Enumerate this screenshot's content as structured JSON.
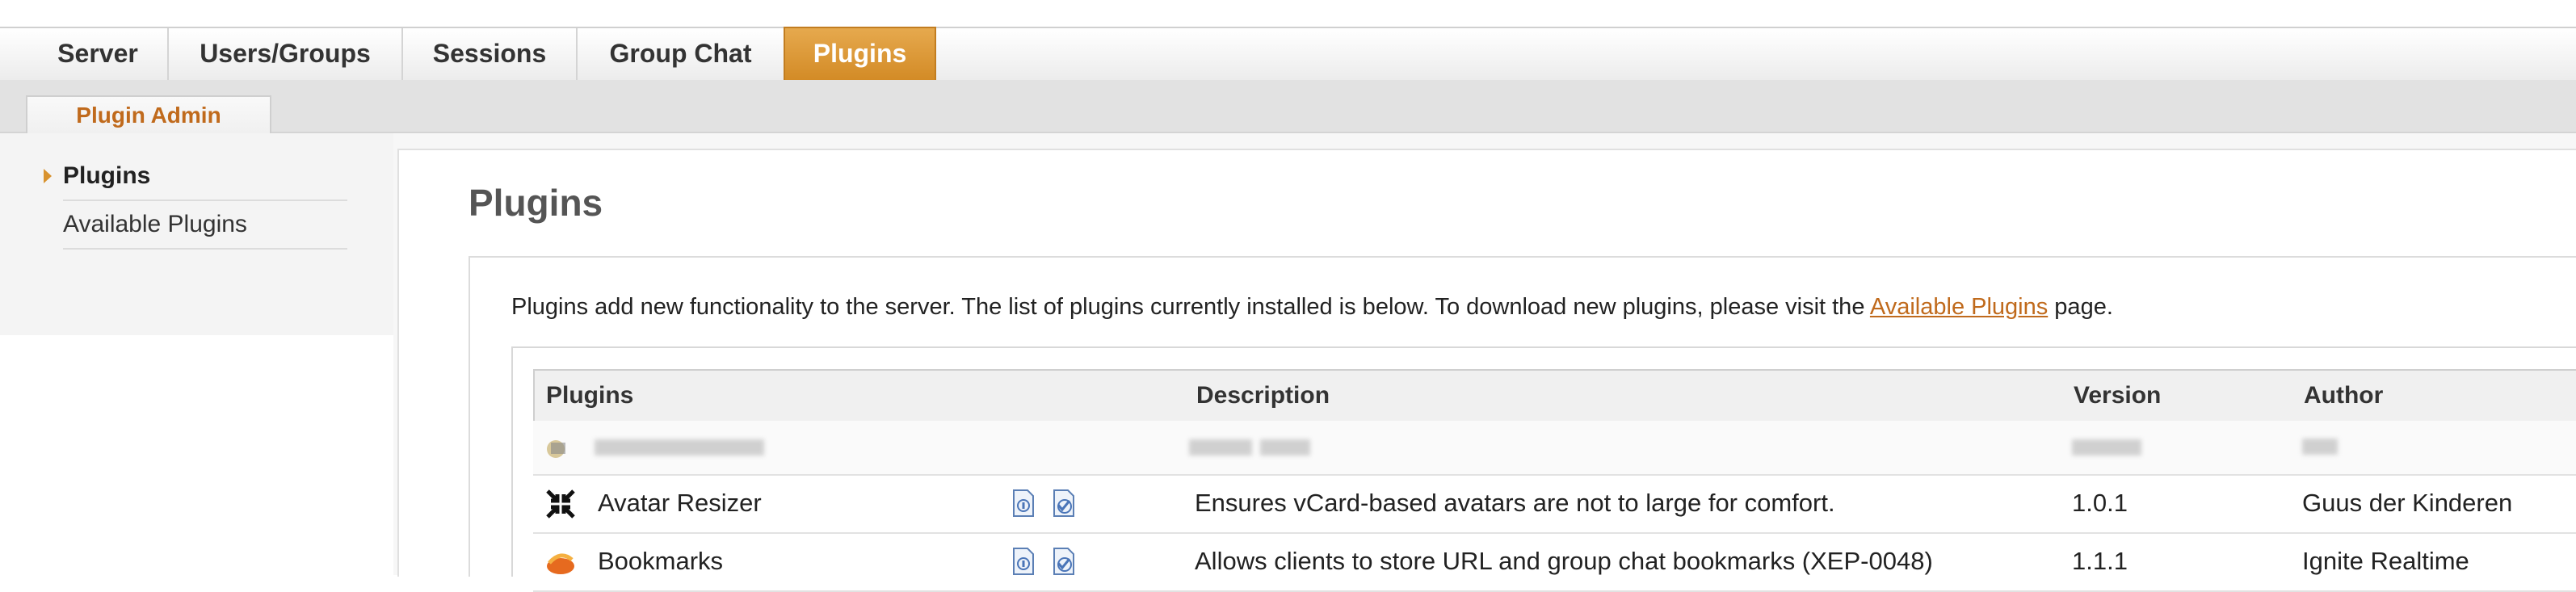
{
  "nav": {
    "tabs": [
      {
        "label": "Server"
      },
      {
        "label": "Users/Groups"
      },
      {
        "label": "Sessions"
      },
      {
        "label": "Group Chat"
      },
      {
        "label": "Plugins",
        "active": true
      }
    ]
  },
  "subnav": {
    "tab": "Plugin Admin"
  },
  "sidebar": {
    "items": [
      {
        "label": "Plugins",
        "active": true
      },
      {
        "label": "Available Plugins"
      }
    ]
  },
  "page": {
    "title": "Plugins",
    "intro_before": "Plugins add new functionality to the server. The list of plugins currently installed is below. To download new plugins, please visit the ",
    "intro_link": "Available Plugins",
    "intro_after": " page."
  },
  "table": {
    "headers": [
      "Plugins",
      "Description",
      "Version",
      "Author"
    ],
    "rows": [
      {
        "name": "Avatar Resizer",
        "description": "Ensures vCard-based avatars are not to large for comfort.",
        "version": "1.0.1",
        "author": "Guus der Kinderen",
        "icon": "avatar-resizer-icon"
      },
      {
        "name": "Bookmarks",
        "description": "Allows clients to store URL and group chat bookmarks (XEP-0048)",
        "version": "1.1.1",
        "author": "Ignite Realtime",
        "icon": "bookmarks-icon"
      }
    ]
  },
  "colors": {
    "accent": "#d8922e",
    "link": "#c06a1c"
  }
}
